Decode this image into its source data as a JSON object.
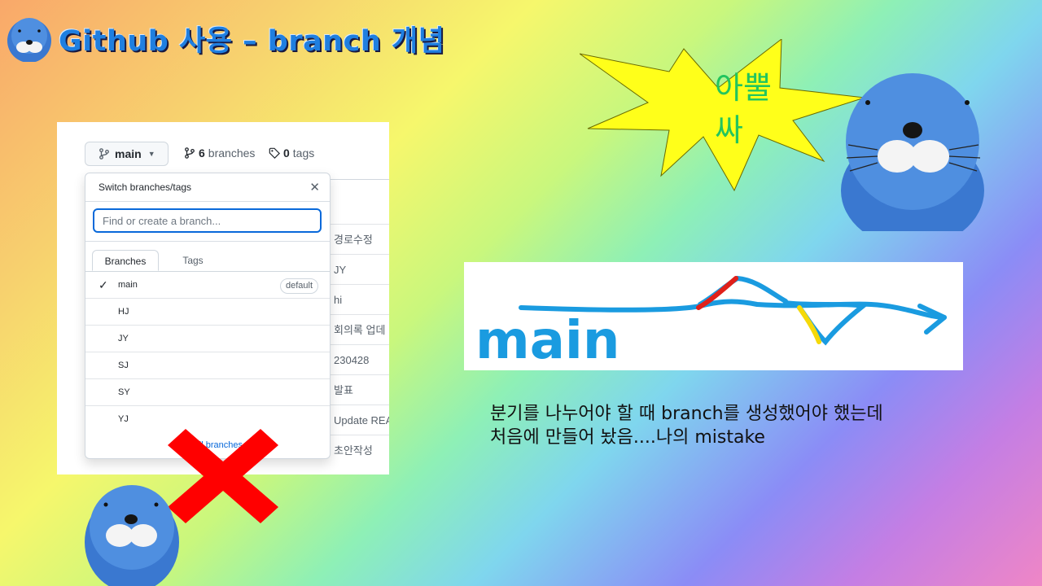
{
  "slide": {
    "title": "Github 사용 – branch 개념",
    "shout": "아뿔싸",
    "caption_lines": [
      "분기를 나누어야 할 때 branch를 생성했어야 했는데",
      "처음에 만들어 놨음....나의 mistake"
    ],
    "diagram_label": "main"
  },
  "github": {
    "branch_button": "main",
    "branches_count": "6",
    "branches_label": "branches",
    "tags_count": "0",
    "tags_label": "tags",
    "dropdown": {
      "title": "Switch branches/tags",
      "search_placeholder": "Find or create a branch...",
      "tabs": [
        "Branches",
        "Tags"
      ],
      "items": [
        {
          "name": "main",
          "badge": "default",
          "checked": true
        },
        {
          "name": "HJ"
        },
        {
          "name": "JY"
        },
        {
          "name": "SJ"
        },
        {
          "name": "SY"
        },
        {
          "name": "YJ"
        }
      ],
      "footer": "View all branches"
    },
    "commit_messages": [
      "경로수정",
      "JY",
      "hi",
      "회의록 업데",
      "230428",
      "발표",
      "Update REA",
      "초안작성"
    ]
  },
  "colors": {
    "title": "#1f7fe0",
    "shout_text": "#22c55e",
    "burst_fill": "#ffff1a",
    "line_blue": "#1a9be0",
    "line_red": "#e0201a",
    "line_yellow": "#f5d90a",
    "x_red": "#ff0000"
  },
  "icons": [
    "git-branch-icon",
    "tag-icon",
    "close-icon",
    "check-icon",
    "seal-mascot"
  ]
}
